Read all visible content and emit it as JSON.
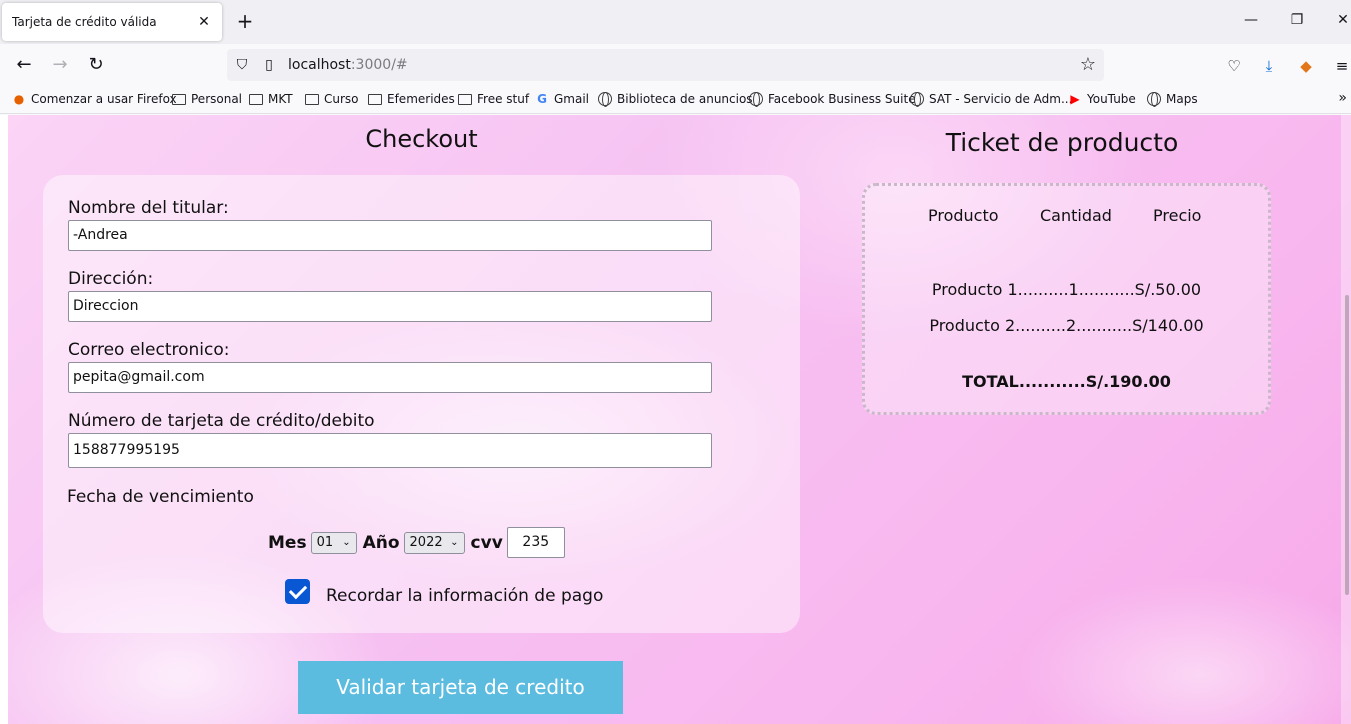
{
  "browser": {
    "tab_title": "Tarjeta de crédito válida",
    "url_host": "localhost",
    "url_rest": ":3000/#",
    "bookmarks": [
      "Comenzar a usar Firefox",
      "Personal",
      "MKT",
      "Curso",
      "Efemerides",
      "Free stuf",
      "Gmail",
      "Biblioteca de anuncios",
      "Facebook Business Suite",
      "SAT - Servicio de Adm...",
      "YouTube",
      "Maps"
    ]
  },
  "checkout": {
    "title": "Checkout",
    "fields": {
      "name_label": "Nombre del titular:",
      "name_value": "-Andrea",
      "address_label": "Dirección:",
      "address_value": "Direccion",
      "email_label": "Correo electronico:",
      "email_value": "pepita@gmail.com",
      "card_label": "Número de tarjeta de crédito/debito",
      "card_value": "158877995195"
    },
    "expiry": {
      "label": "Fecha de vencimiento",
      "month_label": "Mes",
      "month_value": "01",
      "year_label": "Año",
      "year_value": "2022",
      "cvv_label": "cvv",
      "cvv_value": "235"
    },
    "remember_label": "Recordar la información de pago",
    "remember_checked": true,
    "submit_label": "Validar tarjeta de credito"
  },
  "ticket": {
    "title": "Ticket de producto",
    "headers": [
      "Producto",
      "Cantidad",
      "Precio"
    ],
    "rows": [
      "Producto 1..........1...........S/.50.00",
      "Producto 2..........2...........S/140.00"
    ],
    "total": "TOTAL...........S/.190.00"
  },
  "colors": {
    "submit_button": "#5bbce0",
    "checkbox": "#0a57d4",
    "background": "#f8c0ef"
  }
}
